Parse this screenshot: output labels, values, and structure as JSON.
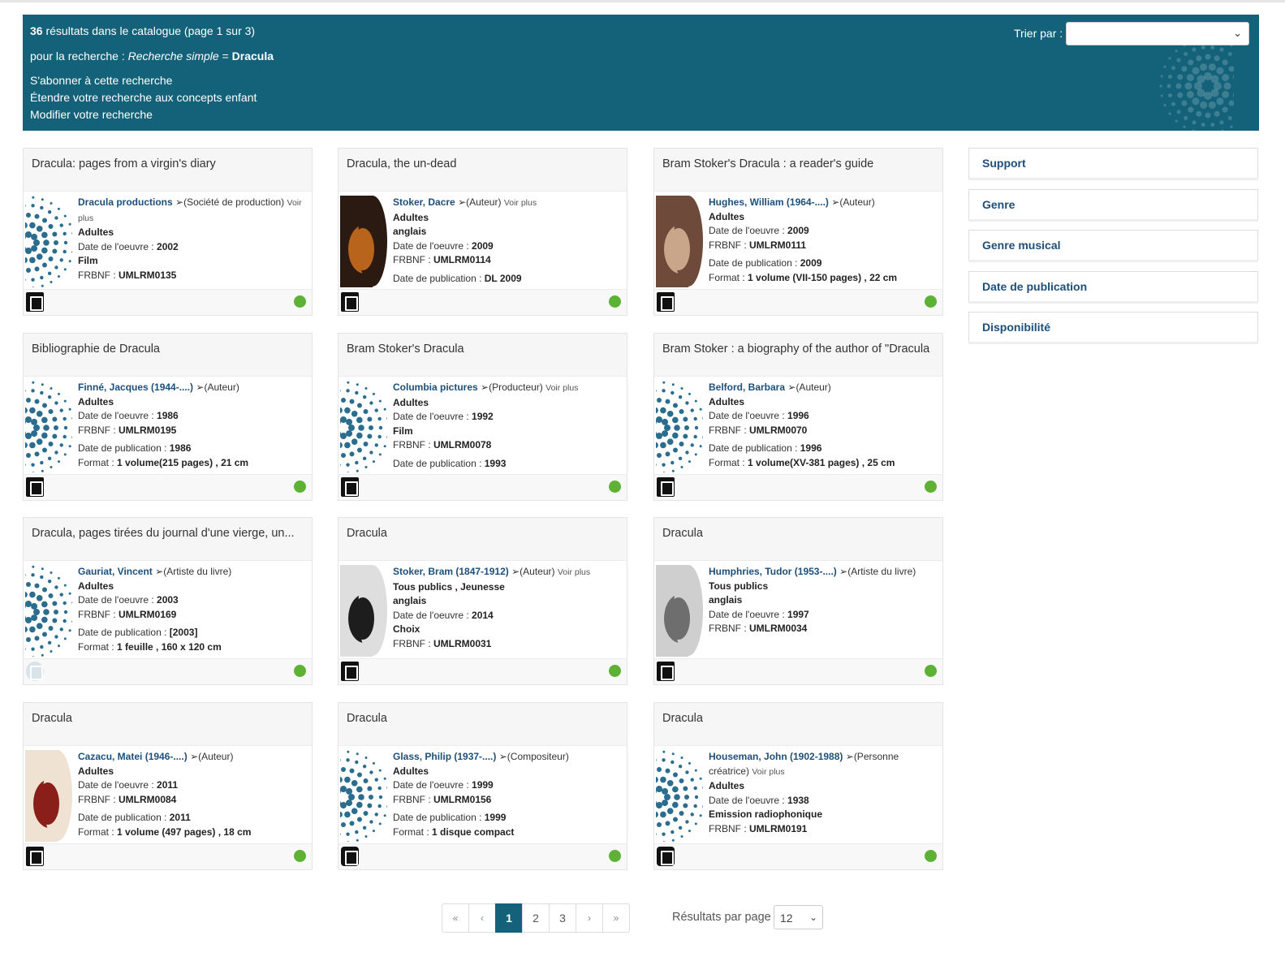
{
  "header": {
    "count": "36",
    "count_suffix": " résultats dans le catalogue (page 1 sur 3)",
    "query_prefix": "pour la recherche : ",
    "query_mode": "Recherche simple",
    "query_eq": " = ",
    "query_term": "Dracula",
    "subscribe": "S'abonner à cette recherche",
    "extend": "Étendre votre recherche aux concepts enfant",
    "modify": "Modifier votre recherche",
    "sort_label": "Trier par :",
    "sort_value": ""
  },
  "labels": {
    "oeuvre_date": "Date de l'oeuvre : ",
    "frbnf": "FRBNF : ",
    "pub_date": "Date de publication : ",
    "format": "Format : ",
    "voir_plus": "Voir plus"
  },
  "results": [
    {
      "title": "Dracula: pages from a virgin's diary",
      "author": "Dracula productions",
      "role": "(Société de production)",
      "voir_plus": true,
      "public": "Adultes",
      "lang": "",
      "oeuvre_date": "2002",
      "type": "Film",
      "frbnf": "UMLRM0135",
      "pub_date": "",
      "format": "",
      "thumb": "dots",
      "icon": "doc-narrow"
    },
    {
      "title": "Dracula, the un-dead",
      "author": "Stoker, Dacre",
      "role": "(Auteur)",
      "voir_plus": true,
      "public": "Adultes",
      "lang": "anglais",
      "oeuvre_date": "2009",
      "type": "",
      "frbnf": "UMLRM0114",
      "pub_date": "DL 2009",
      "format": "",
      "thumb": "cover-dark",
      "icon": "doc"
    },
    {
      "title": "Bram Stoker's Dracula : a reader's guide",
      "author": "Hughes, William (1964-....)",
      "role": "(Auteur)",
      "voir_plus": false,
      "public": "Adultes",
      "lang": "",
      "oeuvre_date": "2009",
      "type": "",
      "frbnf": "UMLRM0111",
      "pub_date": "2009",
      "format": "1 volume (VII-150 pages) , 22 cm",
      "thumb": "cover-building",
      "icon": "doc"
    },
    {
      "title": "Bibliographie de Dracula",
      "author": "Finné, Jacques (1944-....)",
      "role": "(Auteur)",
      "voir_plus": false,
      "public": "Adultes",
      "lang": "",
      "oeuvre_date": "1986",
      "type": "",
      "frbnf": "UMLRM0195",
      "pub_date": "1986",
      "format": "1 volume(215 pages) , 21 cm",
      "thumb": "dots",
      "icon": "doc"
    },
    {
      "title": "Bram Stoker's Dracula",
      "author": "Columbia pictures",
      "role": "(Producteur)",
      "voir_plus": true,
      "public": "Adultes",
      "lang": "",
      "oeuvre_date": "1992",
      "type": "Film",
      "frbnf": "UMLRM0078",
      "pub_date": "1993",
      "format": "",
      "thumb": "dots",
      "icon": "doc-narrow"
    },
    {
      "title": "Bram Stoker : a biography of the author of \"Dracula",
      "author": "Belford, Barbara",
      "role": "(Auteur)",
      "voir_plus": false,
      "public": "Adultes",
      "lang": "",
      "oeuvre_date": "1996",
      "type": "",
      "frbnf": "UMLRM0070",
      "pub_date": "1996",
      "format": "1 volume(XV-381 pages) , 25 cm",
      "thumb": "dots",
      "icon": "doc"
    },
    {
      "title": "Dracula, pages tirées du journal d'une vierge, un...",
      "author": "Gauriat, Vincent",
      "role": "(Artiste du livre)",
      "voir_plus": false,
      "public": "Adultes",
      "lang": "",
      "oeuvre_date": "2003",
      "type": "",
      "frbnf": "UMLRM0169",
      "pub_date": "[2003]",
      "format": "1 feuille , 160 x 120 cm",
      "thumb": "dots",
      "icon": "disc-light"
    },
    {
      "title": "Dracula",
      "author": "Stoker, Bram (1847-1912)",
      "role": "(Auteur)",
      "voir_plus": true,
      "public": "Tous publics , Jeunesse",
      "lang": "anglais",
      "oeuvre_date": "2014",
      "type": "Choix",
      "frbnf": "UMLRM0031",
      "pub_date": "",
      "format": "",
      "thumb": "cover-portrait",
      "icon": "doc"
    },
    {
      "title": "Dracula",
      "author": "Humphries, Tudor (1953-....)",
      "role": "(Artiste du livre)",
      "voir_plus": false,
      "public": "Tous publics",
      "lang": "anglais",
      "oeuvre_date": "1997",
      "type": "",
      "frbnf": "UMLRM0034",
      "pub_date": "",
      "format": "",
      "thumb": "cover-grey",
      "icon": "doc"
    },
    {
      "title": "Dracula",
      "author": "Cazacu, Matei (1946-....)",
      "role": "(Auteur)",
      "voir_plus": false,
      "public": "Adultes",
      "lang": "",
      "oeuvre_date": "2011",
      "type": "",
      "frbnf": "UMLRM0084",
      "pub_date": "2011",
      "format": "1 volume (497 pages) , 18 cm",
      "thumb": "cover-red",
      "icon": "doc"
    },
    {
      "title": "Dracula",
      "author": "Glass, Philip (1937-....)",
      "role": "(Compositeur)",
      "voir_plus": false,
      "public": "Adultes",
      "lang": "",
      "oeuvre_date": "1999",
      "type": "",
      "frbnf": "UMLRM0156",
      "pub_date": "1999",
      "format": "1 disque compact",
      "thumb": "dots",
      "icon": "disc"
    },
    {
      "title": "Dracula",
      "author": "Houseman, John (1902-1988)",
      "role": "(Personne créatrice)",
      "voir_plus": true,
      "public": "Adultes",
      "lang": "",
      "oeuvre_date": "1938",
      "type": "Emission radiophonique",
      "frbnf": "UMLRM0191",
      "pub_date": "",
      "format": "",
      "thumb": "dots",
      "icon": "disc"
    }
  ],
  "facets": [
    "Support",
    "Genre",
    "Genre musical",
    "Date de publication",
    "Disponibilité"
  ],
  "pagination": {
    "first": "«",
    "prev": "‹",
    "pages": [
      "1",
      "2",
      "3"
    ],
    "current": "1",
    "next": "›",
    "last": "»",
    "per_page_label": "Résultats par page",
    "per_page_value": "12"
  },
  "colors": {
    "banner": "#14627a",
    "dots": "#2b6d8e",
    "available": "#5db235",
    "link": "#1d4f7a"
  }
}
